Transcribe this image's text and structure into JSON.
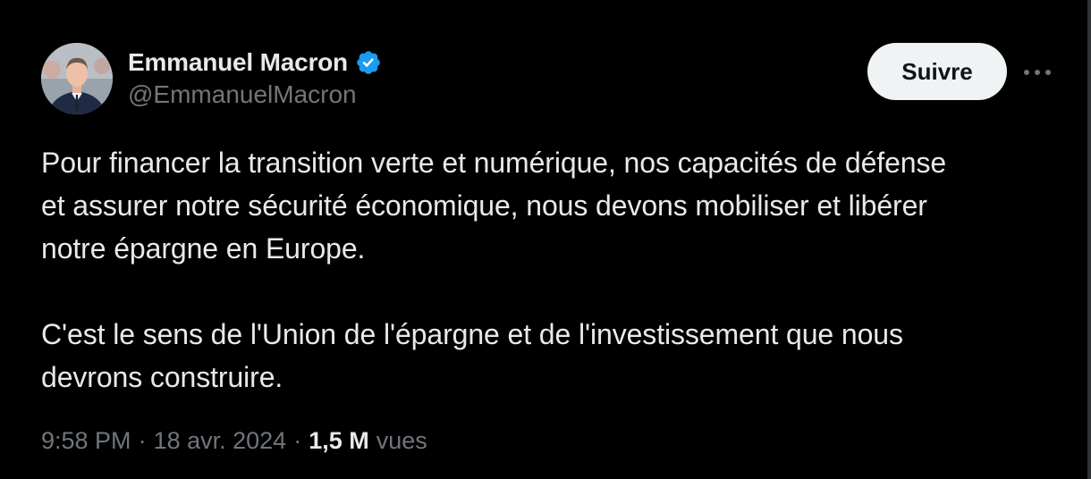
{
  "author": {
    "display_name": "Emmanuel Macron",
    "handle": "@EmmanuelMacron",
    "verified": true
  },
  "actions": {
    "follow_label": "Suivre",
    "more_icon": "more-horizontal-icon"
  },
  "tweet": {
    "lines": [
      "Pour financer la transition verte et numérique, nos capacités de défense",
      "et assurer notre sécurité économique, nous devons mobiliser et libérer",
      "notre épargne en Europe.",
      "C'est le sens de l'Union de l'épargne et de l'investissement que nous",
      "devrons construire."
    ]
  },
  "meta": {
    "time": "9:58 PM",
    "separator": "·",
    "date": "18 avr. 2024",
    "views_count": "1,5 M",
    "views_label": "vues"
  },
  "colors": {
    "background": "#000000",
    "text_primary": "#e7e9ea",
    "text_secondary": "#71767b",
    "verified_blue": "#1d9bf0",
    "button_bg": "#eff3f4"
  }
}
